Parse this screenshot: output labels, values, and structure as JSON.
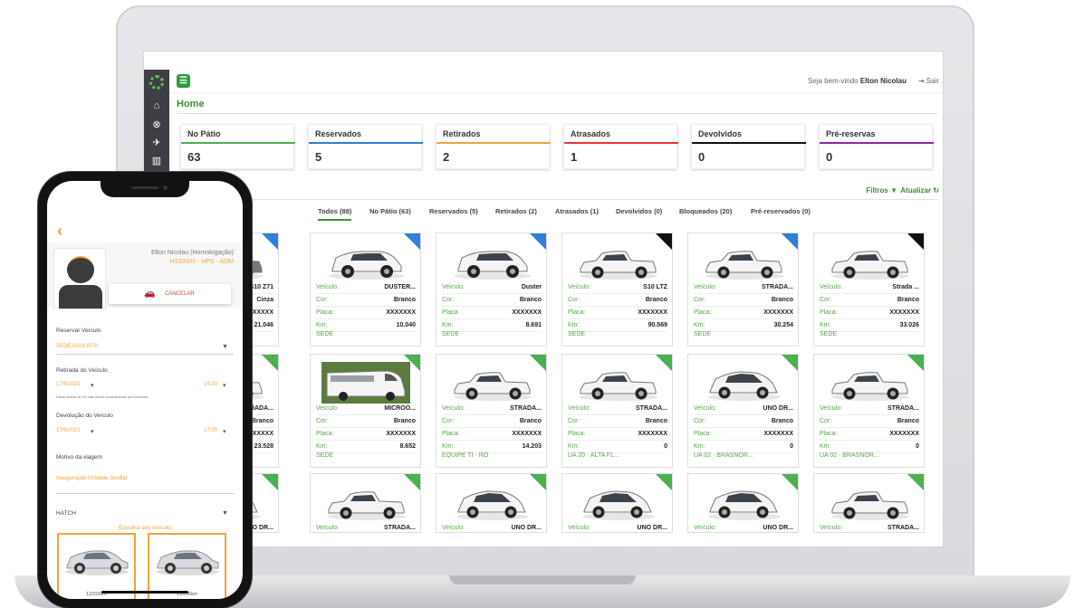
{
  "app": {
    "home_title": "Home",
    "welcome": "Seja bem-vindo",
    "user": "Elton Nicolau",
    "logout": "Sair",
    "section_title": "s",
    "filters": "Filtros",
    "refresh": "Atualizar",
    "colors": {
      "accent": "#3a8f2f",
      "sidebar": "#3d3f44"
    }
  },
  "stats": [
    {
      "label": "No Pátio",
      "value": "63",
      "color": "#4caf50"
    },
    {
      "label": "Reservados",
      "value": "5",
      "color": "#2f80d8"
    },
    {
      "label": "Retirados",
      "value": "2",
      "color": "#f2a33a"
    },
    {
      "label": "Atrasados",
      "value": "1",
      "color": "#e53935"
    },
    {
      "label": "Devolvidos",
      "value": "0",
      "color": "#111111"
    },
    {
      "label": "Pré-reservas",
      "value": "0",
      "color": "#8e24aa"
    }
  ],
  "tabs": [
    "Todos (88)",
    "No Pátio (63)",
    "Reservados (5)",
    "Retirados (2)",
    "Atrasados (1)",
    "Devolvidos (0)",
    "Bloqueados (20)",
    "Pré-reservados (0)"
  ],
  "field_labels": {
    "vehicle": "Veículo:",
    "color": "Cor:",
    "plate": "Placa:",
    "km": "Km:"
  },
  "vehicles": [
    {
      "vehicle": "S10 Z71",
      "color": "Cinza",
      "plate": "XXXXXXX",
      "km": "21.046",
      "location": "",
      "corner": "#2f80d8",
      "type": "pickup",
      "body": "#777777"
    },
    {
      "vehicle": "DUSTER...",
      "color": "Branco",
      "plate": "XXXXXXX",
      "km": "10.040",
      "location": "SEDE",
      "corner": "#2f80d8",
      "type": "suv",
      "body": "#f4f4f4"
    },
    {
      "vehicle": "Duster",
      "color": "Branco",
      "plate": "XXXXXXX",
      "km": "8.691",
      "location": "SEDE",
      "corner": "#2f80d8",
      "type": "suv",
      "body": "#f4f4f4"
    },
    {
      "vehicle": "S10 LTZ",
      "color": "Branco",
      "plate": "XXXXXXX",
      "km": "90.569",
      "location": "SEDE",
      "corner": "#111111",
      "type": "pickup",
      "body": "#f4f4f4"
    },
    {
      "vehicle": "STRADA...",
      "color": "Branco",
      "plate": "XXXXXXX",
      "km": "30.254",
      "location": "SEDE",
      "corner": "#2f80d8",
      "type": "pickup",
      "body": "#f4f4f4"
    },
    {
      "vehicle": "Strada ...",
      "color": "Branco",
      "plate": "XXXXXXX",
      "km": "33.026",
      "location": "SEDE",
      "corner": "#111111",
      "type": "pickup",
      "body": "#f4f4f4"
    },
    {
      "vehicle": "STRADA...",
      "color": "Branco",
      "plate": "XXXXXXX",
      "km": "23.528",
      "location": "",
      "corner": "#4caf50",
      "type": "pickup",
      "body": "#f4f4f4"
    },
    {
      "vehicle": "MICROO...",
      "color": "Branco",
      "plate": "XXXXXXX",
      "km": "8.652",
      "location": "SEDE",
      "corner": "#4caf50",
      "type": "van",
      "body": "#f4f4f4"
    },
    {
      "vehicle": "STRADA...",
      "color": "Branco",
      "plate": "XXXXXXX",
      "km": "14.203",
      "location": "EQUIPE TI - RO",
      "corner": "#4caf50",
      "type": "pickup",
      "body": "#f4f4f4"
    },
    {
      "vehicle": "STRADA...",
      "color": "Branco",
      "plate": "XXXXXXX",
      "km": "0",
      "location": "UA 20 - ALTA FL...",
      "corner": "#4caf50",
      "type": "pickup",
      "body": "#f4f4f4"
    },
    {
      "vehicle": "UNO DR...",
      "color": "Branco",
      "plate": "XXXXXXX",
      "km": "0",
      "location": "UA 02 - BRASNOR...",
      "corner": "#4caf50",
      "type": "hatch",
      "body": "#f4f4f4"
    },
    {
      "vehicle": "STRADA...",
      "color": "Branco",
      "plate": "XXXXXXX",
      "km": "0",
      "location": "UA 02 - BRASNOR...",
      "corner": "#4caf50",
      "type": "pickup",
      "body": "#f4f4f4"
    },
    {
      "vehicle": "UNO DR...",
      "color": "",
      "plate": "",
      "km": "",
      "location": "",
      "corner": "#4caf50",
      "type": "hatch",
      "body": "#f4f4f4"
    },
    {
      "vehicle": "STRADA...",
      "color": "",
      "plate": "",
      "km": "",
      "location": "",
      "corner": "#4caf50",
      "type": "pickup",
      "body": "#f4f4f4"
    },
    {
      "vehicle": "UNO DR...",
      "color": "",
      "plate": "",
      "km": "",
      "location": "",
      "corner": "#4caf50",
      "type": "hatch",
      "body": "#f4f4f4"
    },
    {
      "vehicle": "UNO DR...",
      "color": "",
      "plate": "",
      "km": "",
      "location": "",
      "corner": "#4caf50",
      "type": "hatch",
      "body": "#f4f4f4"
    },
    {
      "vehicle": "UNO DR...",
      "color": "",
      "plate": "",
      "km": "",
      "location": "",
      "corner": "#4caf50",
      "type": "hatch",
      "body": "#f4f4f4"
    },
    {
      "vehicle": "STRADA...",
      "color": "",
      "plate": "",
      "km": "",
      "location": "",
      "corner": "#4caf50",
      "type": "pickup",
      "body": "#f4f4f4"
    }
  ],
  "phone": {
    "user_name": "Elton Nicolau (Homologação)",
    "user_org": "H100003 - HPS - ADM",
    "cancel": "CANCELAR",
    "reserve_label": "Reservar Veículo",
    "branch": "SEDE PAULISTA",
    "pickup_label": "Retirada do Veículo",
    "pickup_date": "17/6/2021",
    "pickup_time": "15:10",
    "note": "Datas acima de 05 dias serão consideradas pré-reservas",
    "return_label": "Devolução do Veículo",
    "return_date": "17/6/2021",
    "return_time": "17:00",
    "reason_label": "Motivo da viagem",
    "reason_value": "Inauguração Unidade Jundiaí",
    "category": "HATCH",
    "choose": "Escolha seu veículo",
    "cars": [
      {
        "km": "12203km"
      },
      {
        "km": "12836km"
      }
    ]
  }
}
